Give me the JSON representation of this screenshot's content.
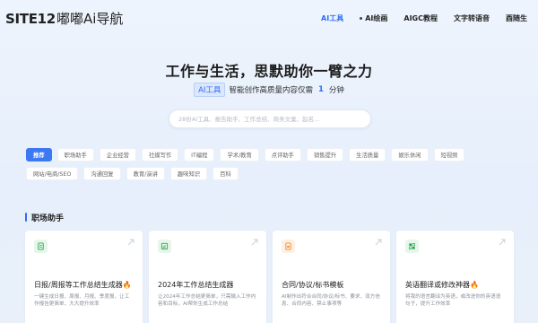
{
  "brand": {
    "logo_main": "SITE12",
    "logo_sub": "嘟嘟Ai导航"
  },
  "nav": {
    "items": [
      {
        "label": "AI工具",
        "active": true
      },
      {
        "label": "AI绘画",
        "active": false
      },
      {
        "label": "AIGC教程",
        "active": false
      },
      {
        "label": "文字转语音",
        "active": false
      },
      {
        "label": "酉随生",
        "active": false
      }
    ]
  },
  "hero": {
    "title": "工作与生活，思默助你一臂之力",
    "badge": "AI工具",
    "subtitle_prefix": "智能创作高质量内容仅需",
    "subtitle_num": "1",
    "subtitle_suffix": "分钟"
  },
  "search": {
    "placeholder": "28份AI工具、报告助手、工作总结、商务文案、起名..."
  },
  "chips": [
    {
      "label": "推荐",
      "active": true
    },
    {
      "label": "职场助手",
      "active": false
    },
    {
      "label": "企业经营",
      "active": false
    },
    {
      "label": "社媒写作",
      "active": false
    },
    {
      "label": "IT编程",
      "active": false
    },
    {
      "label": "学术/教育",
      "active": false
    },
    {
      "label": "点评助手",
      "active": false
    },
    {
      "label": "销售提升",
      "active": false
    },
    {
      "label": "生活质量",
      "active": false
    },
    {
      "label": "娱乐休闲",
      "active": false
    },
    {
      "label": "短视频",
      "active": false
    },
    {
      "label": "网站/电商/SEO",
      "active": false
    },
    {
      "label": "沟通回复",
      "active": false
    },
    {
      "label": "教育/演讲",
      "active": false
    },
    {
      "label": "趣味知识",
      "active": false
    },
    {
      "label": "百科",
      "active": false
    }
  ],
  "section": {
    "title": "职场助手"
  },
  "cards": [
    {
      "title": "日报/周报等工作总结生成器🔥",
      "desc": "一键生成日报、周报、月报、季度报，让工作报告更简单、大大提升效率",
      "icon": "file-icon",
      "icon_bg": "#e7f6ea",
      "icon_color": "#27a64a"
    },
    {
      "title": "2024年工作总结生成器",
      "desc": "让2024年工作总结更简单，只需输入工作内容和目标，AI帮你生成工作总结",
      "icon": "chart-icon",
      "icon_bg": "#e7f6ea",
      "icon_color": "#27a64a"
    },
    {
      "title": "合同/协议/标书模板",
      "desc": "AI制作出符合合同/协议/标书、要求、双方信息、合同内容、禁止事项等",
      "icon": "contract-icon",
      "icon_bg": "#fdf0e3",
      "icon_color": "#ef8a2b"
    },
    {
      "title": "英语翻译或修改神器🔥",
      "desc": "将我的语言翻译为英语，或改进你的英语语句子，提升工作效率",
      "icon": "translate-icon",
      "icon_bg": "#e7f6ea",
      "icon_color": "#27a64a"
    }
  ],
  "colors": {
    "accent": "#2f6ef2",
    "chip_active": "#3b78f2"
  }
}
